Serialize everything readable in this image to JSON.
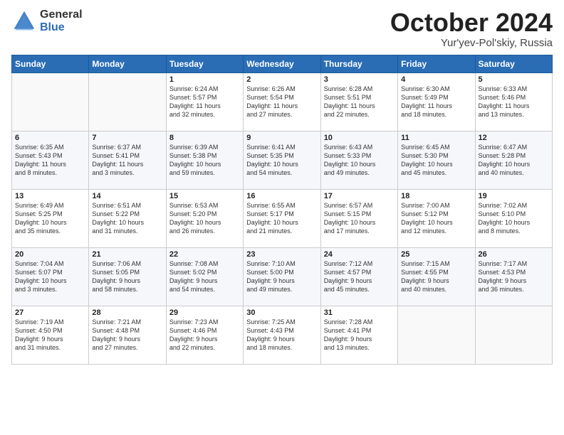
{
  "logo": {
    "general": "General",
    "blue": "Blue"
  },
  "title": "October 2024",
  "subtitle": "Yur'yev-Pol'skiy, Russia",
  "days_of_week": [
    "Sunday",
    "Monday",
    "Tuesday",
    "Wednesday",
    "Thursday",
    "Friday",
    "Saturday"
  ],
  "weeks": [
    [
      {
        "day": "",
        "detail": ""
      },
      {
        "day": "",
        "detail": ""
      },
      {
        "day": "1",
        "detail": "Sunrise: 6:24 AM\nSunset: 5:57 PM\nDaylight: 11 hours\nand 32 minutes."
      },
      {
        "day": "2",
        "detail": "Sunrise: 6:26 AM\nSunset: 5:54 PM\nDaylight: 11 hours\nand 27 minutes."
      },
      {
        "day": "3",
        "detail": "Sunrise: 6:28 AM\nSunset: 5:51 PM\nDaylight: 11 hours\nand 22 minutes."
      },
      {
        "day": "4",
        "detail": "Sunrise: 6:30 AM\nSunset: 5:49 PM\nDaylight: 11 hours\nand 18 minutes."
      },
      {
        "day": "5",
        "detail": "Sunrise: 6:33 AM\nSunset: 5:46 PM\nDaylight: 11 hours\nand 13 minutes."
      }
    ],
    [
      {
        "day": "6",
        "detail": "Sunrise: 6:35 AM\nSunset: 5:43 PM\nDaylight: 11 hours\nand 8 minutes."
      },
      {
        "day": "7",
        "detail": "Sunrise: 6:37 AM\nSunset: 5:41 PM\nDaylight: 11 hours\nand 3 minutes."
      },
      {
        "day": "8",
        "detail": "Sunrise: 6:39 AM\nSunset: 5:38 PM\nDaylight: 10 hours\nand 59 minutes."
      },
      {
        "day": "9",
        "detail": "Sunrise: 6:41 AM\nSunset: 5:35 PM\nDaylight: 10 hours\nand 54 minutes."
      },
      {
        "day": "10",
        "detail": "Sunrise: 6:43 AM\nSunset: 5:33 PM\nDaylight: 10 hours\nand 49 minutes."
      },
      {
        "day": "11",
        "detail": "Sunrise: 6:45 AM\nSunset: 5:30 PM\nDaylight: 10 hours\nand 45 minutes."
      },
      {
        "day": "12",
        "detail": "Sunrise: 6:47 AM\nSunset: 5:28 PM\nDaylight: 10 hours\nand 40 minutes."
      }
    ],
    [
      {
        "day": "13",
        "detail": "Sunrise: 6:49 AM\nSunset: 5:25 PM\nDaylight: 10 hours\nand 35 minutes."
      },
      {
        "day": "14",
        "detail": "Sunrise: 6:51 AM\nSunset: 5:22 PM\nDaylight: 10 hours\nand 31 minutes."
      },
      {
        "day": "15",
        "detail": "Sunrise: 6:53 AM\nSunset: 5:20 PM\nDaylight: 10 hours\nand 26 minutes."
      },
      {
        "day": "16",
        "detail": "Sunrise: 6:55 AM\nSunset: 5:17 PM\nDaylight: 10 hours\nand 21 minutes."
      },
      {
        "day": "17",
        "detail": "Sunrise: 6:57 AM\nSunset: 5:15 PM\nDaylight: 10 hours\nand 17 minutes."
      },
      {
        "day": "18",
        "detail": "Sunrise: 7:00 AM\nSunset: 5:12 PM\nDaylight: 10 hours\nand 12 minutes."
      },
      {
        "day": "19",
        "detail": "Sunrise: 7:02 AM\nSunset: 5:10 PM\nDaylight: 10 hours\nand 8 minutes."
      }
    ],
    [
      {
        "day": "20",
        "detail": "Sunrise: 7:04 AM\nSunset: 5:07 PM\nDaylight: 10 hours\nand 3 minutes."
      },
      {
        "day": "21",
        "detail": "Sunrise: 7:06 AM\nSunset: 5:05 PM\nDaylight: 9 hours\nand 58 minutes."
      },
      {
        "day": "22",
        "detail": "Sunrise: 7:08 AM\nSunset: 5:02 PM\nDaylight: 9 hours\nand 54 minutes."
      },
      {
        "day": "23",
        "detail": "Sunrise: 7:10 AM\nSunset: 5:00 PM\nDaylight: 9 hours\nand 49 minutes."
      },
      {
        "day": "24",
        "detail": "Sunrise: 7:12 AM\nSunset: 4:57 PM\nDaylight: 9 hours\nand 45 minutes."
      },
      {
        "day": "25",
        "detail": "Sunrise: 7:15 AM\nSunset: 4:55 PM\nDaylight: 9 hours\nand 40 minutes."
      },
      {
        "day": "26",
        "detail": "Sunrise: 7:17 AM\nSunset: 4:53 PM\nDaylight: 9 hours\nand 36 minutes."
      }
    ],
    [
      {
        "day": "27",
        "detail": "Sunrise: 7:19 AM\nSunset: 4:50 PM\nDaylight: 9 hours\nand 31 minutes."
      },
      {
        "day": "28",
        "detail": "Sunrise: 7:21 AM\nSunset: 4:48 PM\nDaylight: 9 hours\nand 27 minutes."
      },
      {
        "day": "29",
        "detail": "Sunrise: 7:23 AM\nSunset: 4:46 PM\nDaylight: 9 hours\nand 22 minutes."
      },
      {
        "day": "30",
        "detail": "Sunrise: 7:25 AM\nSunset: 4:43 PM\nDaylight: 9 hours\nand 18 minutes."
      },
      {
        "day": "31",
        "detail": "Sunrise: 7:28 AM\nSunset: 4:41 PM\nDaylight: 9 hours\nand 13 minutes."
      },
      {
        "day": "",
        "detail": ""
      },
      {
        "day": "",
        "detail": ""
      }
    ]
  ]
}
